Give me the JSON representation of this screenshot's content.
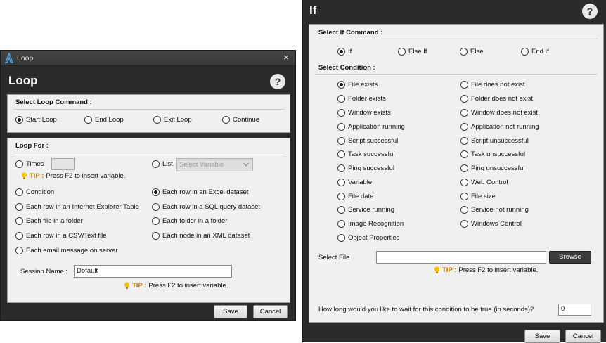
{
  "loop_window": {
    "titlebar_title": "Loop",
    "close_glyph": "×",
    "heading": "Loop",
    "help_glyph": "?",
    "command_section": {
      "title": "Select Loop Command :",
      "options": [
        "Start Loop",
        "End Loop",
        "Exit Loop",
        "Continue"
      ],
      "selected": "Start Loop"
    },
    "loop_for": {
      "title": "Loop For :",
      "times_label": "Times",
      "times_value": "",
      "list_label": "List",
      "list_placeholder": "Select Variable",
      "options_left": [
        "Condition",
        "Each row in an Internet Explorer Table",
        "Each file in a folder",
        "Each row in a CSV/Text file",
        "Each email message on server"
      ],
      "options_right": [
        "Each row in an Excel dataset",
        "Each row in a SQL query dataset",
        "Each folder in a folder",
        "Each node in an XML dataset"
      ],
      "selected": "Each row in an Excel dataset",
      "session_label": "Session Name :",
      "session_value": "Default"
    },
    "tip_key": "TIP :",
    "tip_text": "Press F2 to insert variable.",
    "save_label": "Save",
    "cancel_label": "Cancel"
  },
  "if_window": {
    "heading": "If",
    "help_glyph": "?",
    "command_section": {
      "title": "Select If Command :",
      "options": [
        "If",
        "Else If",
        "Else",
        "End If"
      ],
      "selected": "If"
    },
    "condition_section": {
      "title": "Select Condition :",
      "left": [
        "File exists",
        "Folder exists",
        "Window exists",
        "Application running",
        "Script successful",
        "Task successful",
        "Ping successful",
        "Variable",
        "File date",
        "Service running",
        "Image Recognition",
        "Object Properties"
      ],
      "right": [
        "File does not exist",
        "Folder does not exist",
        "Window does not exist",
        "Application not running",
        "Script unsuccessful",
        "Task unsuccessful",
        "Ping unsuccessful",
        "Web Control",
        "File size",
        "Service not running",
        "Windows Control"
      ],
      "selected": "File exists"
    },
    "select_file_label": "Select File",
    "select_file_value": "",
    "browse_label": "Browse",
    "tip_key": "TIP :",
    "tip_text": "Press F2 to insert variable.",
    "wait_label": "How long would you like to wait for this condition to be true (in seconds)?",
    "wait_value": "0",
    "save_label": "Save",
    "cancel_label": "Cancel"
  },
  "colors": {
    "window_bg": "#2b2b2b",
    "panel_bg": "#f0f0f0",
    "tip_accent": "#c97a00",
    "bulb": "#f2c200",
    "app_icon": "#4aa3df"
  },
  "icons": [
    "app-logo-icon",
    "close-icon",
    "help-icon",
    "lightbulb-icon",
    "chevron-down-icon"
  ]
}
